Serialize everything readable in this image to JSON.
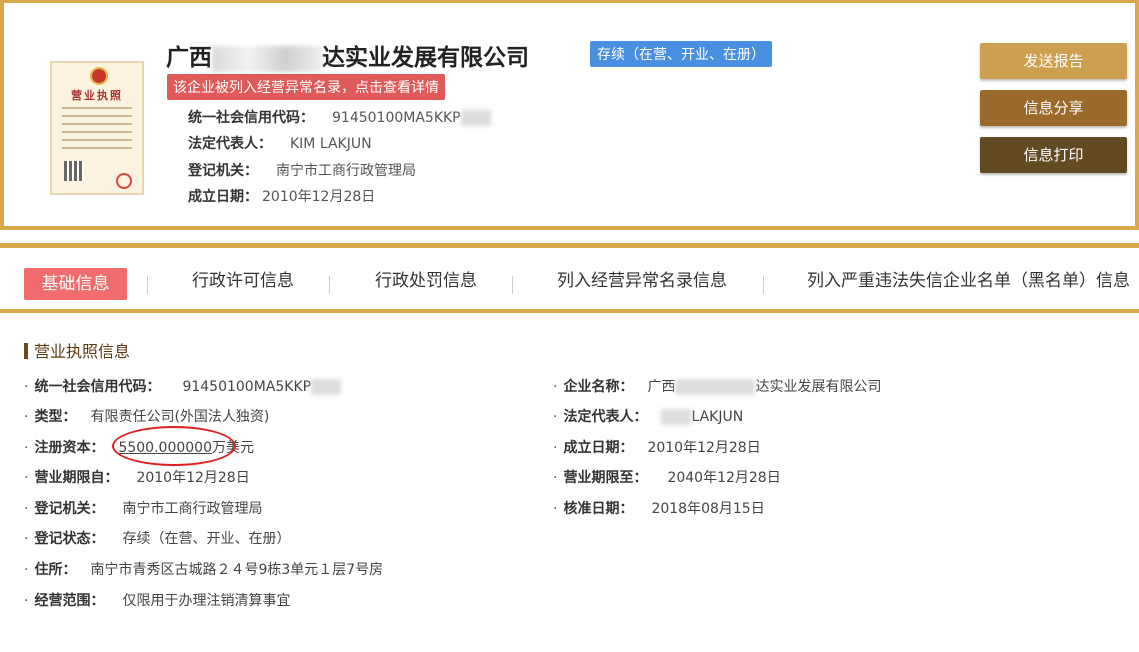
{
  "header": {
    "company_name_start": "广西",
    "company_name_end": "达实业发展有限公司",
    "status": "存续（在营、开业、在册）",
    "abnormal_notice": "该企业被列入经营异常名录，点击查看详情",
    "credit_code_label": "统一社会信用代码：",
    "credit_code_value": "91450100MA5KKP",
    "legal_rep_label": "法定代表人：",
    "legal_rep_value": "KIM LAKJUN",
    "registration_authority_label": "登记机关：",
    "registration_authority_value": "南宁市工商行政管理局",
    "established_label": "成立日期：",
    "established_value": "2010年12月28日",
    "license_title": "营业执照"
  },
  "actions": {
    "send_report": "发送报告",
    "share_info": "信息分享",
    "print_info": "信息打印"
  },
  "tabs": [
    {
      "label": "基础信息"
    },
    {
      "label": "行政许可信息"
    },
    {
      "label": "行政处罚信息"
    },
    {
      "label": "列入经营异常名录信息"
    },
    {
      "label": "列入严重违法失信企业名单（黑名单）信息"
    }
  ],
  "section": {
    "title": "营业执照信息",
    "left_fields": [
      {
        "label": "统一社会信用代码：",
        "value": "91450100MA5KKP"
      },
      {
        "label": "类型：",
        "value": "有限责任公司(外国法人独资)"
      },
      {
        "label": "注册资本：",
        "value": "5500.000000",
        "suffix": "万美元"
      },
      {
        "label": "营业期限自：",
        "value": "2010年12月28日"
      },
      {
        "label": "登记机关：",
        "value": "南宁市工商行政管理局"
      },
      {
        "label": "登记状态：",
        "value": "存续（在营、开业、在册）"
      },
      {
        "label": "住所：",
        "value": "南宁市青秀区古城路２４号9栋3单元１层7号房"
      },
      {
        "label": "经营范围：",
        "value": "仅限用于办理注销清算事宜"
      }
    ],
    "right_fields": [
      {
        "label": "企业名称：",
        "value_start": "广西",
        "value_end": "达实业发展有限公司"
      },
      {
        "label": "法定代表人：",
        "value": "LAKJUN"
      },
      {
        "label": "成立日期：",
        "value": "2010年12月28日"
      },
      {
        "label": "营业期限至：",
        "value": "2040年12月28日"
      },
      {
        "label": "核准日期：",
        "value": "2018年08月15日"
      }
    ]
  }
}
